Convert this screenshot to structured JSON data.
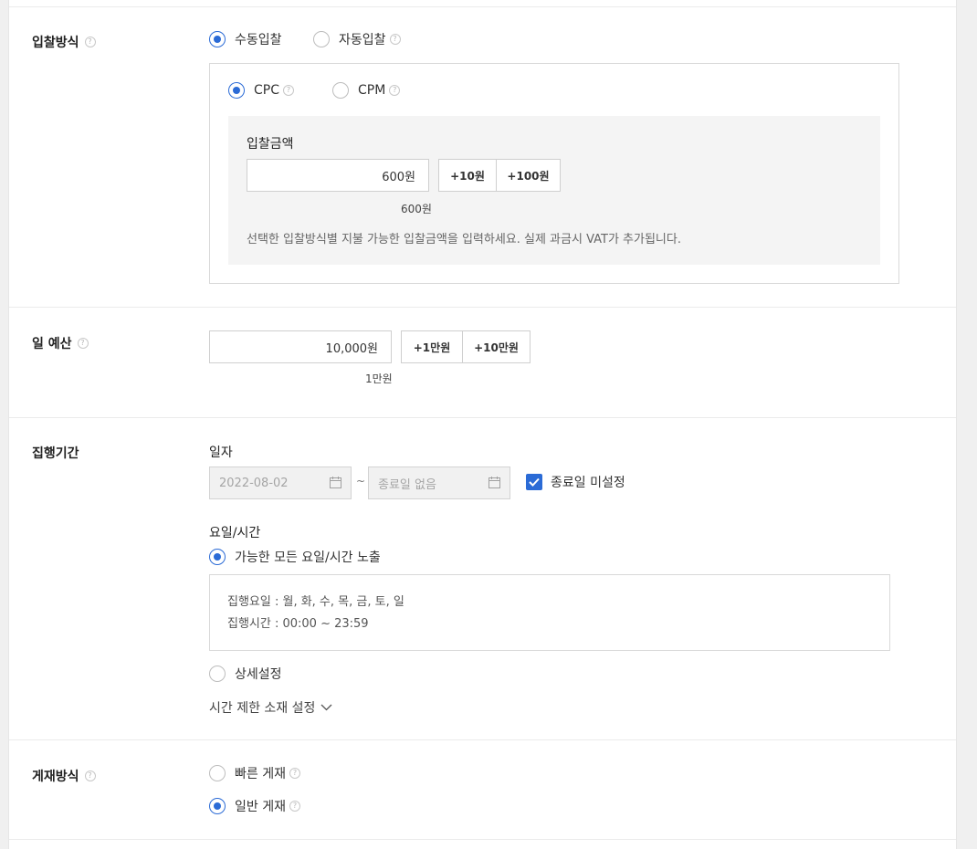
{
  "bidding": {
    "title": "입찰방식",
    "options": [
      {
        "label": "수동입찰",
        "selected": true,
        "help": false
      },
      {
        "label": "자동입찰",
        "selected": false,
        "help": true
      }
    ],
    "type_options": [
      {
        "label": "CPC",
        "selected": true
      },
      {
        "label": "CPM",
        "selected": false
      }
    ],
    "amount_label": "입찰금액",
    "amount_value": "600원",
    "add_10": "+10원",
    "add_100": "+100원",
    "amount_caption": "600원",
    "hint": "선택한 입찰방식별 지불 가능한 입찰금액을 입력하세요. 실제 과금시 VAT가 추가됩니다."
  },
  "budget": {
    "title": "일 예산",
    "value": "10,000원",
    "add_1": "+1만원",
    "add_10": "+10만원",
    "caption": "1만원"
  },
  "period": {
    "title": "집행기간",
    "date_label": "일자",
    "start_date": "2022-08-02",
    "separator": "~",
    "end_placeholder": "종료일 없음",
    "no_end_label": "종료일 미설정",
    "no_end_checked": true,
    "day_time_label": "요일/시간",
    "option_all": "가능한 모든 요일/시간 노출",
    "days_line": "집행요일 : 월, 화, 수, 목, 금, 토, 일",
    "time_line": "집행시간 : 00:00 ~ 23:59",
    "option_detail": "상세설정",
    "time_limit_label": "시간 제한 소재 설정"
  },
  "placement": {
    "title": "게재방식",
    "options": [
      {
        "label": "빠른 게재",
        "selected": false
      },
      {
        "label": "일반 게재",
        "selected": true
      }
    ]
  },
  "colors": {
    "accent": "#2b6bd6",
    "border": "#d9d9d9",
    "graybox": "#f4f4f4"
  }
}
